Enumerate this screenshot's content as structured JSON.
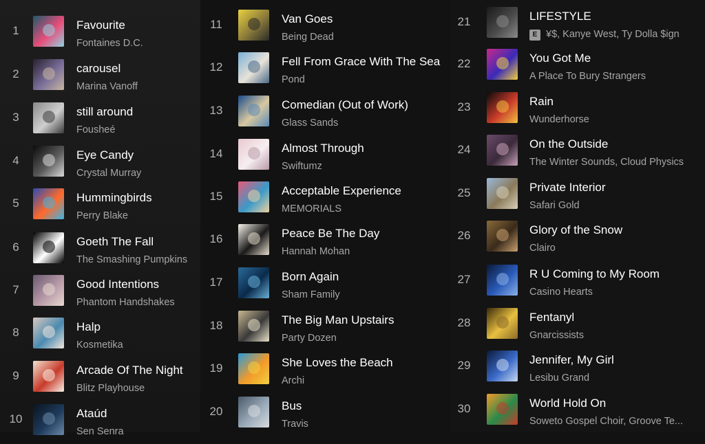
{
  "tracks": [
    {
      "n": "1",
      "title": "Favourite",
      "artist": "Fontaines D.C.",
      "art": [
        "#1d5a6b",
        "#e84d7a",
        "#8fd3e0"
      ]
    },
    {
      "n": "2",
      "title": "carousel",
      "artist": "Marina Vanoff",
      "art": [
        "#2a2030",
        "#7a6f9a",
        "#c8b6a0"
      ]
    },
    {
      "n": "3",
      "title": "still around",
      "artist": "Fousheé",
      "art": [
        "#8a8a8a",
        "#cfcfcf",
        "#3a3a3a"
      ]
    },
    {
      "n": "4",
      "title": "Eye Candy",
      "artist": "Crystal Murray",
      "art": [
        "#0c0c0c",
        "#5a5a5a",
        "#d8d8d8"
      ]
    },
    {
      "n": "5",
      "title": "Hummingbirds",
      "artist": "Perry Blake",
      "art": [
        "#2a4bb5",
        "#ff6a2a",
        "#3bb6e8"
      ]
    },
    {
      "n": "6",
      "title": "Goeth The Fall",
      "artist": "The Smashing Pumpkins",
      "art": [
        "#000000",
        "#ffffff",
        "#000000"
      ]
    },
    {
      "n": "7",
      "title": "Good Intentions",
      "artist": "Phantom Handshakes",
      "art": [
        "#6a5a70",
        "#b89aa8",
        "#e8d8d0"
      ]
    },
    {
      "n": "8",
      "title": "Halp",
      "artist": "Kosmetika",
      "art": [
        "#d8c8c0",
        "#4a8ab0",
        "#f2e6dc"
      ]
    },
    {
      "n": "9",
      "title": "Arcade Of The Night",
      "artist": "Blitz Playhouse",
      "art": [
        "#f2e2d0",
        "#c83a2a",
        "#f7f0e6"
      ]
    },
    {
      "n": "10",
      "title": "Ataúd",
      "artist": "Sen Senra",
      "art": [
        "#0a1420",
        "#1e3a5a",
        "#6a8aa8"
      ]
    },
    {
      "n": "11",
      "title": "Van Goes",
      "artist": "Being Dead",
      "art": [
        "#e8d040",
        "#8a7a3a",
        "#2a2a2a"
      ]
    },
    {
      "n": "12",
      "title": "Fell From Grace With The Sea",
      "artist": "Pond",
      "art": [
        "#7ab0d8",
        "#e8e2d8",
        "#4a6a88"
      ]
    },
    {
      "n": "13",
      "title": "Comedian (Out of Work)",
      "artist": "Glass Sands",
      "art": [
        "#1a4a8a",
        "#d8c8a0",
        "#5a8ab8"
      ]
    },
    {
      "n": "14",
      "title": "Almost Through",
      "artist": "Swiftumz",
      "art": [
        "#e8c8d0",
        "#f6eef0",
        "#b89aa8"
      ]
    },
    {
      "n": "15",
      "title": "Acceptable Experience",
      "artist": "MEMORIALS",
      "art": [
        "#e85a7a",
        "#3a9ac8",
        "#f0d0a0"
      ]
    },
    {
      "n": "16",
      "title": "Peace Be The Day",
      "artist": "Hannah Mohan",
      "art": [
        "#f6f2ea",
        "#1a1a1a",
        "#e6dccc"
      ]
    },
    {
      "n": "17",
      "title": "Born Again",
      "artist": "Sham Family",
      "art": [
        "#2a6a9a",
        "#0a2a4a",
        "#6ab0d8"
      ]
    },
    {
      "n": "18",
      "title": "The Big Man Upstairs",
      "artist": "Party Dozen",
      "art": [
        "#c8b890",
        "#3a3a3a",
        "#e8e0c8"
      ]
    },
    {
      "n": "19",
      "title": "She Loves the Beach",
      "artist": "Archi",
      "art": [
        "#2a9ad8",
        "#f29a2a",
        "#f2d040"
      ]
    },
    {
      "n": "20",
      "title": "Bus",
      "artist": "Travis",
      "art": [
        "#4a5a6a",
        "#9aaab8",
        "#d8dce0"
      ]
    },
    {
      "n": "21",
      "title": "LIFESTYLE",
      "artist": "¥$, Kanye West, Ty Dolla $ign",
      "explicit": "E",
      "art": [
        "#1a1a1a",
        "#4a4a4a",
        "#8a8a8a"
      ]
    },
    {
      "n": "22",
      "title": "You Got Me",
      "artist": "A Place To Bury Strangers",
      "art": [
        "#c82a8a",
        "#3a2ab8",
        "#f2d040"
      ]
    },
    {
      "n": "23",
      "title": "Rain",
      "artist": "Wunderhorse",
      "art": [
        "#0a0a0a",
        "#c83a2a",
        "#f2c040"
      ]
    },
    {
      "n": "24",
      "title": "On the Outside",
      "artist": "The Winter Sounds, Cloud Physics",
      "art": [
        "#6a4a6a",
        "#3a2a3a",
        "#c8a0b8"
      ]
    },
    {
      "n": "25",
      "title": "Private Interior",
      "artist": "Safari Gold",
      "art": [
        "#9ab8d8",
        "#8a7a5a",
        "#d8d0b8"
      ]
    },
    {
      "n": "26",
      "title": "Glory of the Snow",
      "artist": "Clairo",
      "art": [
        "#8a6a3a",
        "#3a2a1a",
        "#c8a070"
      ]
    },
    {
      "n": "27",
      "title": "R U Coming to My Room",
      "artist": "Casino Hearts",
      "art": [
        "#0a1a3a",
        "#2a5ab8",
        "#8ab0e8"
      ]
    },
    {
      "n": "28",
      "title": "Fentanyl",
      "artist": "Gnarcissists",
      "art": [
        "#3a2a0a",
        "#e8c040",
        "#8a6a2a"
      ]
    },
    {
      "n": "29",
      "title": "Jennifer, My Girl",
      "artist": "Lesibu Grand",
      "art": [
        "#0a1a3a",
        "#3a6ac8",
        "#c8d8f0"
      ]
    },
    {
      "n": "30",
      "title": "World Hold On",
      "artist": "Soweto Gospel Choir, Groove Te...",
      "art": [
        "#f29a2a",
        "#2a8a4a",
        "#c83a2a"
      ]
    }
  ]
}
